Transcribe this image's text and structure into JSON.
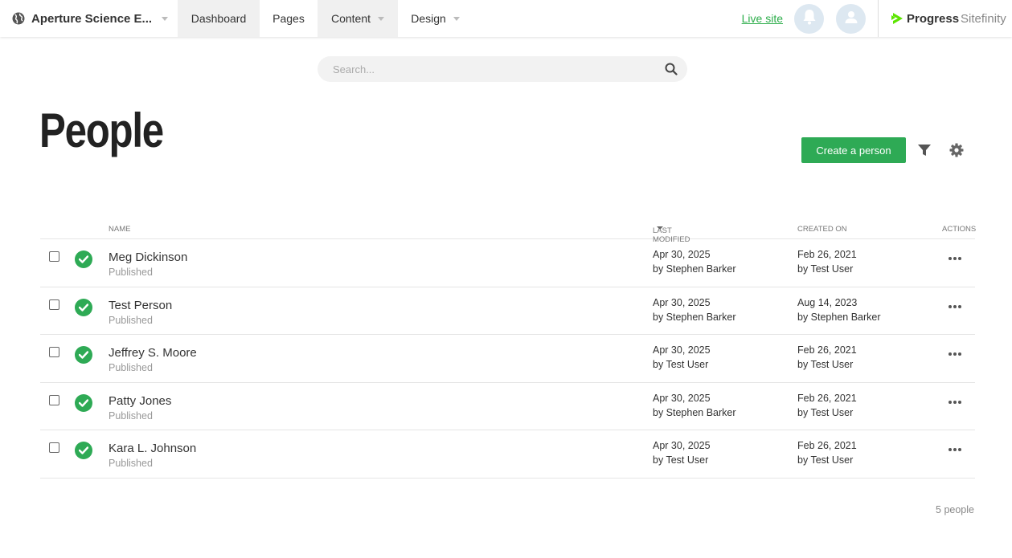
{
  "topbar": {
    "site_name": "Aperture Science E...",
    "nav": {
      "dashboard": "Dashboard",
      "pages": "Pages",
      "content": "Content",
      "design": "Design"
    },
    "live_site": "Live site",
    "logo_progress": "Progress",
    "logo_sitefinity": "Sitefinity",
    "accent_color": "#2cad4a"
  },
  "search": {
    "placeholder": "Search..."
  },
  "page": {
    "title": "People",
    "create_label": "Create a person"
  },
  "table": {
    "headers": {
      "name": "NAME",
      "last_modified": "LAST MODIFIED",
      "created_on": "CREATED ON",
      "actions": "ACTIONS"
    },
    "rows": [
      {
        "name": "Meg Dickinson",
        "status": "Published",
        "modified_date": "Apr 30, 2025",
        "modified_by": "by Stephen Barker",
        "created_date": "Feb 26, 2021",
        "created_by": "by Test User"
      },
      {
        "name": "Test Person",
        "status": "Published",
        "modified_date": "Apr 30, 2025",
        "modified_by": "by Stephen Barker",
        "created_date": "Aug 14, 2023",
        "created_by": "by Stephen Barker"
      },
      {
        "name": "Jeffrey S. Moore",
        "status": "Published",
        "modified_date": "Apr 30, 2025",
        "modified_by": "by Test User",
        "created_date": "Feb 26, 2021",
        "created_by": "by Test User"
      },
      {
        "name": "Patty Jones",
        "status": "Published",
        "modified_date": "Apr 30, 2025",
        "modified_by": "by Stephen Barker",
        "created_date": "Feb 26, 2021",
        "created_by": "by Test User"
      },
      {
        "name": "Kara L. Johnson",
        "status": "Published",
        "modified_date": "Apr 30, 2025",
        "modified_by": "by Test User",
        "created_date": "Feb 26, 2021",
        "created_by": "by Test User"
      }
    ]
  },
  "footer": {
    "count": "5 people"
  }
}
